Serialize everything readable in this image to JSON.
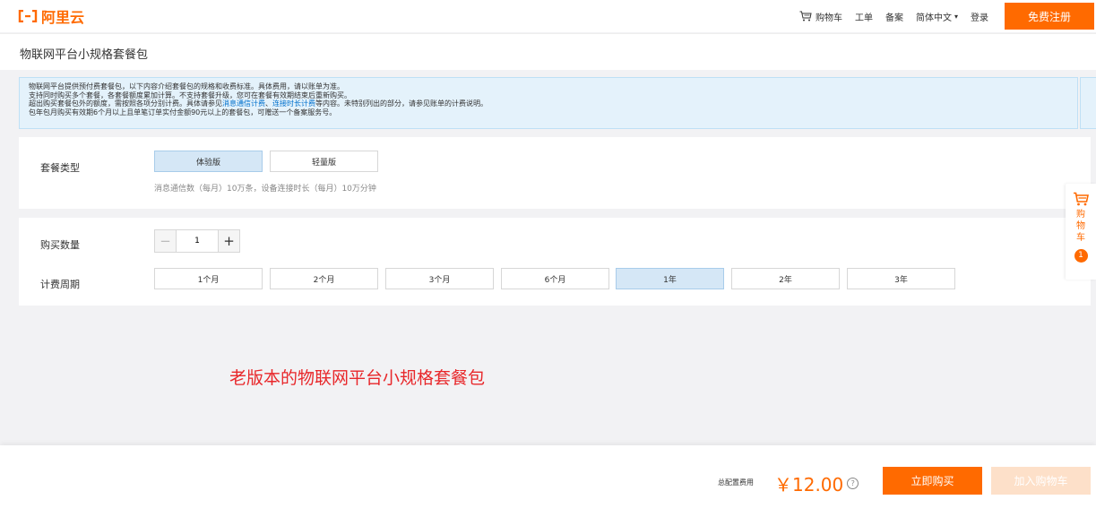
{
  "header": {
    "logo_text": "阿里云",
    "nav": {
      "cart": "购物车",
      "ticket": "工单",
      "icp": "备案",
      "language": "简体中文",
      "login": "登录"
    },
    "register_label": "免费注册",
    "brand_color": "#ff6a00"
  },
  "page_title": "物联网平台小规格套餐包",
  "notice": {
    "line1": "物联网平台提供预付费套餐包，以下内容介绍套餐包的规格和收费标准。具体费用，请以账单为准。",
    "line2": "支持同时购买多个套餐，各套餐额度累加计算。不支持套餐升级，您可在套餐有效期结束后重新购买。",
    "line3_before": "超出购买套餐包外的额度，需按照各项分别计费。具体请参见",
    "line3_link1": "消息通信计费",
    "line3_sep": "、",
    "line3_link2": "连接时长计费",
    "line3_after": "等内容。未特别列出的部分，请参见账单的计费说明。",
    "line4": "包年包月购买有效期6个月以上且单笔订单实付金额90元以上的套餐包，可赠送一个备案服务号。"
  },
  "package": {
    "label": "套餐类型",
    "options": [
      "体验版",
      "轻量版"
    ],
    "selected": "体验版",
    "hint": "消息通信数（每月）10万条，设备连接时长（每月）10万分钟"
  },
  "purchase": {
    "quantity_label": "购买数量",
    "quantity_value": "1",
    "period_label": "计费周期",
    "periods": [
      "1个月",
      "2个月",
      "3个月",
      "6个月",
      "1年",
      "2年",
      "3年"
    ],
    "selected_period": "1年"
  },
  "annotation": "老版本的物联网平台小规格套餐包",
  "side_cart": {
    "label": "购物车",
    "count": "1"
  },
  "footer": {
    "total_label": "总配置费用",
    "price": "￥12.00",
    "help_icon": "?",
    "buy_label": "立即购买",
    "add_cart_label": "加入购物车"
  }
}
